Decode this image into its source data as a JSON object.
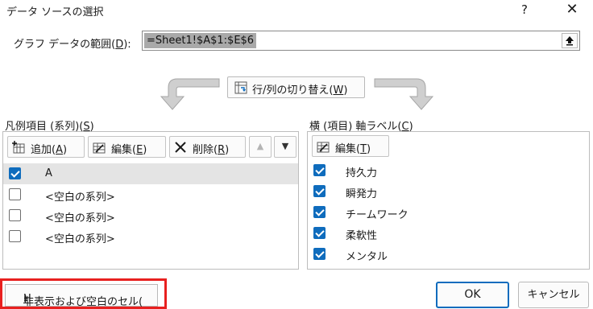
{
  "window": {
    "title": "データ ソースの選択",
    "help_glyph": "?",
    "close_glyph": "✕"
  },
  "range": {
    "label_prefix": "グラフ データの範囲(",
    "label_key": "D",
    "label_suffix": "):",
    "value": "=Sheet1!$A$1:$E$6"
  },
  "switch_button": {
    "label_prefix": "行/列の切り替え(",
    "label_key": "W",
    "label_suffix": ")"
  },
  "legend": {
    "heading_prefix": "凡例項目 (系列)(",
    "heading_key": "S",
    "heading_suffix": ")",
    "add": {
      "prefix": "追加(",
      "key": "A",
      "suffix": ")"
    },
    "edit": {
      "prefix": "編集(",
      "key": "E",
      "suffix": ")"
    },
    "remove": {
      "prefix": "削除(",
      "key": "R",
      "suffix": ")"
    },
    "move_up_glyph": "▲",
    "move_down_glyph": "▼",
    "items": [
      {
        "label": "A",
        "checked": true,
        "selected": true
      },
      {
        "label": "<空白の系列>",
        "checked": false,
        "selected": false
      },
      {
        "label": "<空白の系列>",
        "checked": false,
        "selected": false
      },
      {
        "label": "<空白の系列>",
        "checked": false,
        "selected": false
      }
    ]
  },
  "axis": {
    "heading_prefix": "横 (項目) 軸ラベル(",
    "heading_key": "C",
    "heading_suffix": ")",
    "edit": {
      "prefix": "編集(",
      "key": "T",
      "suffix": ")"
    },
    "items": [
      {
        "label": "持久力",
        "checked": true
      },
      {
        "label": "瞬発力",
        "checked": true
      },
      {
        "label": "チームワーク",
        "checked": true
      },
      {
        "label": "柔軟性",
        "checked": true
      },
      {
        "label": "メンタル",
        "checked": true
      }
    ]
  },
  "footer": {
    "hidden_cells": {
      "prefix": "非表示および空白のセル(",
      "key": "H",
      "suffix": ")"
    },
    "ok": "OK",
    "cancel": "キャンセル"
  },
  "colors": {
    "accent": "#0f6cbd",
    "highlight": "#e8201f",
    "selection": "#e4e4e4"
  }
}
